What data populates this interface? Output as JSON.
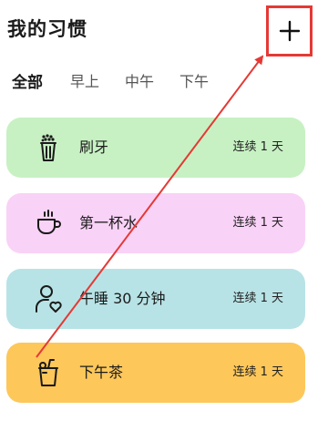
{
  "header": {
    "title": "我的习惯",
    "add_icon": "plus-icon"
  },
  "tabs": [
    {
      "label": "全部",
      "active": true
    },
    {
      "label": "早上",
      "active": false
    },
    {
      "label": "中午",
      "active": false
    },
    {
      "label": "下午",
      "active": false
    }
  ],
  "habits": [
    {
      "name": "刷牙",
      "streak": "连续 1 天",
      "icon": "toothbrush-cup-icon",
      "color": "#c7f1c3"
    },
    {
      "name": "第一杯水",
      "streak": "连续 1 天",
      "icon": "teacup-icon",
      "color": "#f9d2f7"
    },
    {
      "name": "午睡 30 分钟",
      "streak": "连续 1 天",
      "icon": "person-heart-icon",
      "color": "#b8e3e6"
    },
    {
      "name": "下午茶",
      "streak": "连续 1 天",
      "icon": "drink-cup-icon",
      "color": "#fdc75a"
    }
  ],
  "annotation": {
    "highlight_color": "#e53935"
  }
}
